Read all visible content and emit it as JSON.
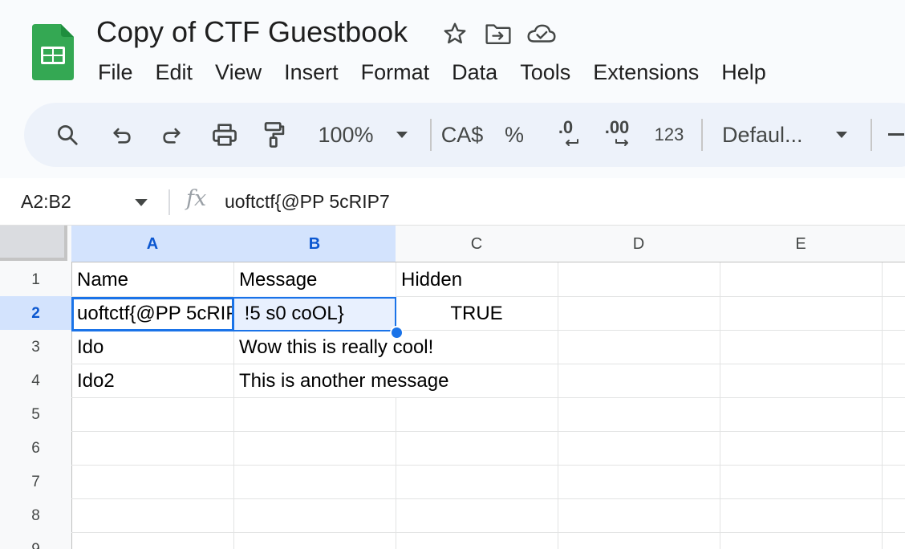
{
  "app": {
    "doc_title": "Copy of CTF Guestbook",
    "title_icons": [
      "star-icon",
      "move-folder-icon",
      "cloud-saved-icon"
    ]
  },
  "menu": [
    "File",
    "Edit",
    "View",
    "Insert",
    "Format",
    "Data",
    "Tools",
    "Extensions",
    "Help"
  ],
  "toolbar": {
    "zoom": "100%",
    "currency": "CA$",
    "percent": "%",
    "decrease_decimal": ".0",
    "increase_decimal": ".00",
    "number_format": "123",
    "font": "Defaul..."
  },
  "formula_bar": {
    "name_box": "A2:B2",
    "fx_label": "fx",
    "value": "uoftctf{@PP 5cRIP7"
  },
  "grid": {
    "columns": [
      "A",
      "B",
      "C",
      "D",
      "E"
    ],
    "rows": [
      "1",
      "2",
      "3",
      "4",
      "5",
      "6",
      "7",
      "8",
      "9"
    ],
    "cells": [
      [
        "Name",
        "Message",
        "Hidden",
        "",
        ""
      ],
      [
        "uoftctf{@PP 5cRIP7",
        " !5 s0 coOL}",
        "TRUE",
        "",
        ""
      ],
      [
        "Ido",
        "Wow this is really cool!",
        "",
        "",
        ""
      ],
      [
        "Ido2",
        "This is another message",
        "",
        "",
        ""
      ]
    ]
  },
  "colors": {
    "selection_blue": "#1a73e8",
    "header_selected": "#d3e3fd",
    "toolbar_bg": "#edf2fa",
    "sheets_green": "#188038"
  }
}
